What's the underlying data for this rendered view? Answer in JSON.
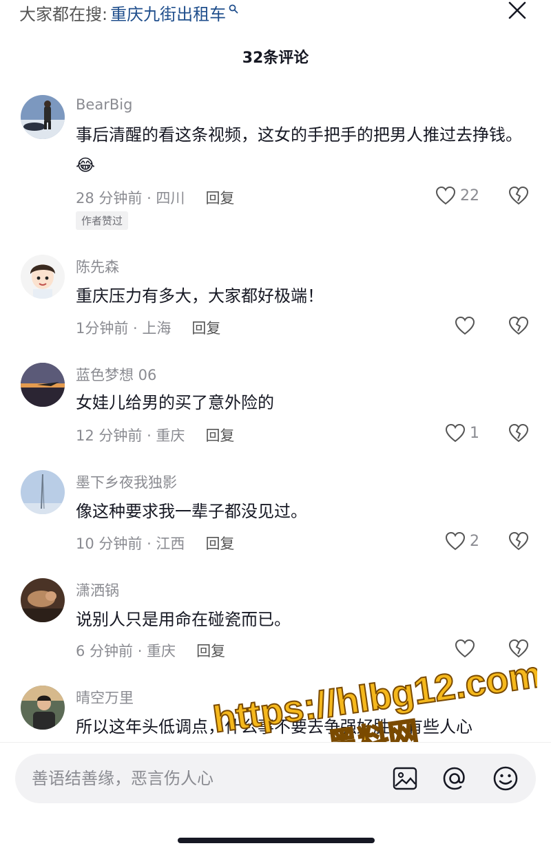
{
  "search_hint": {
    "prefix": "大家都在搜:",
    "query": "重庆九街出租车"
  },
  "comment_count": "32条评论",
  "comments": [
    {
      "username": "BearBig",
      "text": "事后清醒的看这条视频，这女的手把手的把男人推过去挣钱。😂",
      "meta": "28 分钟前 · 四川",
      "reply": "回复",
      "likes": "22",
      "badge": "作者赞过"
    },
    {
      "username": "陈先森",
      "text": "重庆压力有多大，大家都好极端！",
      "meta": "1分钟前 · 上海",
      "reply": "回复",
      "likes": ""
    },
    {
      "username": "蓝色梦想 06",
      "text": "女娃儿给男的买了意外险的",
      "meta": "12 分钟前 · 重庆",
      "reply": "回复",
      "likes": "1"
    },
    {
      "username": "墨下乡夜我独影",
      "text": "像这种要求我一辈子都没见过。",
      "meta": "10 分钟前 · 江西",
      "reply": "回复",
      "likes": "2"
    },
    {
      "username": "潇洒锅",
      "text": "说别人只是用命在碰瓷而已。",
      "meta": "6 分钟前 · 重庆",
      "reply": "回复",
      "likes": ""
    },
    {
      "username": "晴空万里",
      "text": "所以这年头低调点，什么事不要去争强好胜，有些人心",
      "meta": "",
      "reply": "",
      "likes": ""
    }
  ],
  "watermark": {
    "line1": "https://hlbg12.com",
    "line2": "黑料网"
  },
  "input": {
    "placeholder": "善语结善缘，恶言伤人心"
  },
  "colors": {
    "accent_link": "#1f4e8c",
    "muted": "#8a8b91",
    "text": "#161823",
    "watermark": "#f5b81c"
  }
}
